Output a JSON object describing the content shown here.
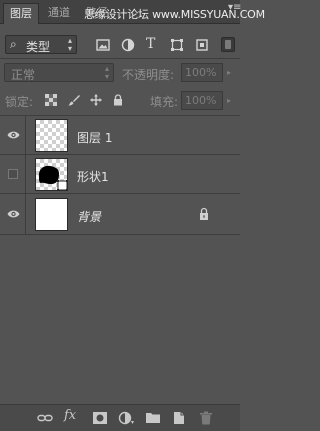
{
  "tabs": [
    {
      "label": "图层",
      "active": true
    },
    {
      "label": "通道",
      "active": false
    },
    {
      "label": "路径",
      "active": false
    }
  ],
  "watermark": "思缘设计论坛 www.MISSYUAN.COM",
  "filter": {
    "kind_label": "类型",
    "kind_options_visible": "类型",
    "icons": [
      "image-filter-icon",
      "adjustment-filter-icon",
      "type-filter-icon",
      "shape-filter-icon",
      "smart-object-filter-icon"
    ],
    "type_filter_glyph": "T"
  },
  "blend": {
    "mode": "正常",
    "opacity_label": "不透明度:",
    "opacity_value": "100%"
  },
  "lock": {
    "label": "锁定:",
    "fill_label": "填充:",
    "fill_value": "100%"
  },
  "layers": [
    {
      "name": "图层 1",
      "visible": true,
      "thumbnail": "transparent"
    },
    {
      "name": "形状1",
      "visible": false,
      "thumbnail": "shape"
    },
    {
      "name": "背景",
      "visible": true,
      "thumbnail": "white",
      "locked": true
    }
  ],
  "bottom_toolbar": {
    "fx_label": "fx",
    "icons": [
      "link-icon",
      "fx-icon",
      "mask-icon",
      "adjustment-icon",
      "folder-icon",
      "new-layer-icon",
      "trash-icon"
    ]
  },
  "colors": {
    "panel_bg": "#535353",
    "tabbar_bg": "#424242",
    "text": "#e4e4e4",
    "disabled_text": "#8e8e8e"
  }
}
